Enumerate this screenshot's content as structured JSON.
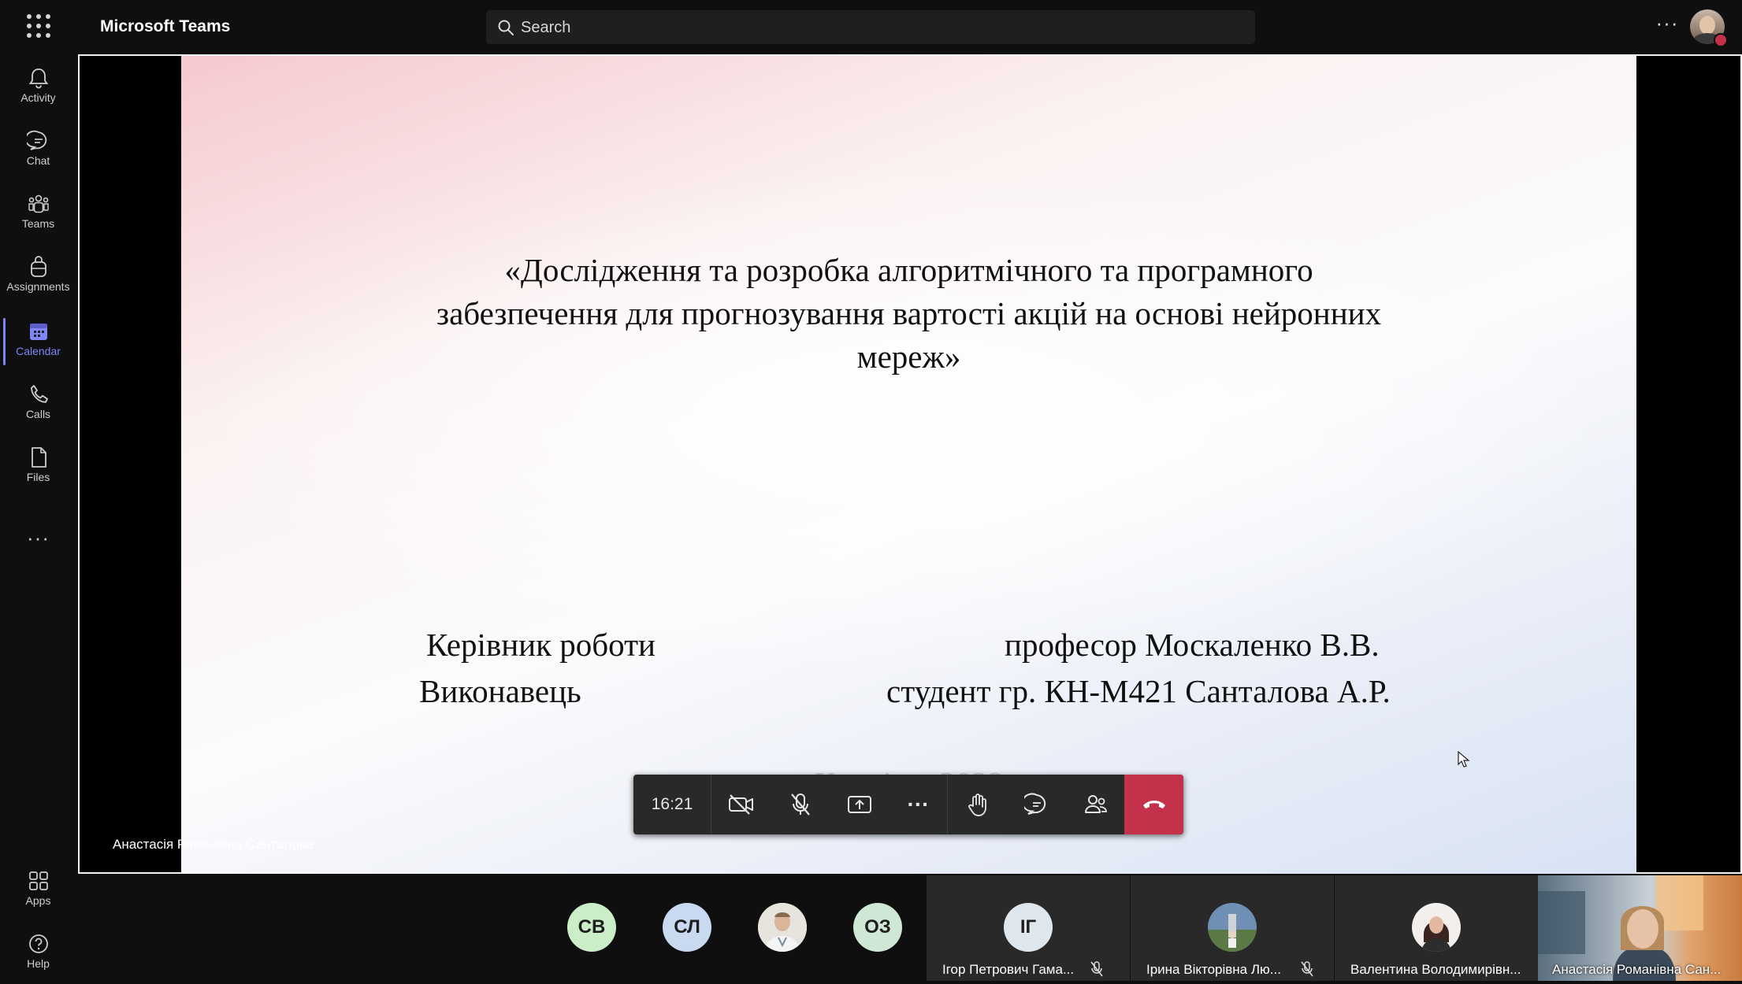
{
  "app": {
    "title": "Microsoft Teams"
  },
  "search": {
    "placeholder": "Search"
  },
  "top_more_label": "···",
  "rail": {
    "items": [
      {
        "label": "Activity"
      },
      {
        "label": "Chat"
      },
      {
        "label": "Teams"
      },
      {
        "label": "Assignments"
      },
      {
        "label": "Calendar"
      },
      {
        "label": "Calls"
      },
      {
        "label": "Files"
      }
    ],
    "more_label": "···",
    "bottom": [
      {
        "label": "Apps"
      },
      {
        "label": "Help"
      }
    ]
  },
  "slide": {
    "title_lines": [
      "«Дослідження та розробка алгоритмічного та програмного",
      "забезпечення для прогнозування вартості акцій на основі нейронних",
      "мереж»"
    ],
    "supervisor_role": "Керівник роботи",
    "supervisor_name": "професор Москаленко В.В.",
    "author_role": "Виконавець",
    "author_name": "студент гр. КН-М421 Санталова А.Р.",
    "city_year": "Харків – 2022"
  },
  "presenter_name": "Анастасія Романівна Санталова",
  "controls": {
    "timer": "16:21",
    "more_label": "···"
  },
  "participants": {
    "circles": [
      {
        "initials": "СВ",
        "color": "#cbeec9"
      },
      {
        "initials": "СЛ",
        "color": "#c9d9f0"
      },
      {
        "initials": "ОЗ",
        "color": "#cfe8d6"
      }
    ],
    "tiles": [
      {
        "initials": "ІГ",
        "name": "Ігор Петрович Гама...",
        "muted": true
      },
      {
        "name": "Ірина Вікторівна Лю...",
        "muted": true
      },
      {
        "name": "Валентина Володимирівн..."
      },
      {
        "name": "Анастасія Романівна Сан..."
      }
    ]
  },
  "colors": {
    "brand_accent": "#7f85f5",
    "hangup": "#c4314b",
    "background": "#0f0f0f"
  }
}
